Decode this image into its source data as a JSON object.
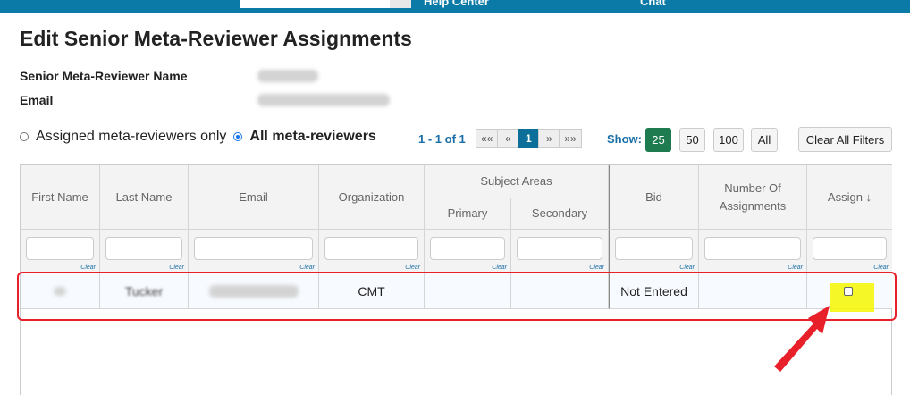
{
  "topbar": {
    "help_center": "Help Center",
    "chat": "Chat"
  },
  "page": {
    "title": "Edit Senior Meta-Reviewer Assignments",
    "name_label": "Senior Meta-Reviewer Name",
    "email_label": "Email"
  },
  "filters": {
    "radio_assigned": "Assigned meta-reviewers only",
    "radio_all": "All meta-reviewers",
    "selected": "all"
  },
  "pagination": {
    "info": "1 - 1 of 1",
    "first": "««",
    "prev": "«",
    "current": "1",
    "next": "»",
    "last": "»»"
  },
  "show": {
    "label": "Show:",
    "options": [
      "25",
      "50",
      "100",
      "All"
    ],
    "selected": "25"
  },
  "clear_all": "Clear All Filters",
  "table": {
    "headers": {
      "first_name": "First Name",
      "last_name": "Last Name",
      "email": "Email",
      "organization": "Organization",
      "subject_areas": "Subject Areas",
      "primary": "Primary",
      "secondary": "Secondary",
      "bid": "Bid",
      "num_assignments_1": "Number Of",
      "num_assignments_2": "Assignments",
      "assign": "Assign ↓"
    },
    "filter_clear": "Clear",
    "row": {
      "first_name": "",
      "last_name": "Tucker",
      "email": "@         m",
      "organization": "CMT",
      "primary": "",
      "secondary": "",
      "bid": "Not Entered",
      "num_assignments": "",
      "assigned": false
    }
  },
  "colors": {
    "topbar": "#0b7aa6",
    "accent": "#1b6fa8",
    "pager_active": "#0b6f99",
    "show_active": "#1e7a4f",
    "annotation": "#e8202a",
    "highlight": "#f6f600"
  }
}
